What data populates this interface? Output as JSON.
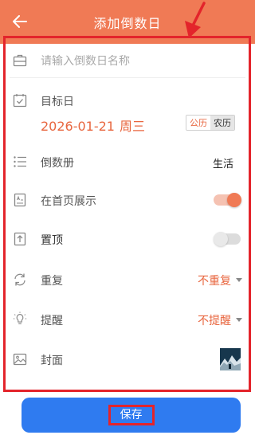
{
  "header": {
    "title": "添加倒数日",
    "back_icon": "arrow-left-icon",
    "background": "#f07a55"
  },
  "form": {
    "name_placeholder": "请输入倒数日名称",
    "target_day": {
      "label": "目标日",
      "date": "2026-01-21",
      "weekday": "周三",
      "calendar_options": [
        "公历",
        "农历"
      ],
      "calendar_selected": "公历"
    },
    "book": {
      "label": "倒数册",
      "value": "生活"
    },
    "show_on_home": {
      "label": "在首页展示",
      "enabled": true
    },
    "pin_top": {
      "label": "置顶",
      "enabled": false
    },
    "repeat": {
      "label": "重复",
      "value": "不重复"
    },
    "reminder": {
      "label": "提醒",
      "value": "不提醒"
    },
    "cover": {
      "label": "封面"
    }
  },
  "footer": {
    "save_label": "保存",
    "button_color": "#2f7bf0"
  },
  "colors": {
    "accent": "#e8663f",
    "annotation": "#e3242b"
  }
}
